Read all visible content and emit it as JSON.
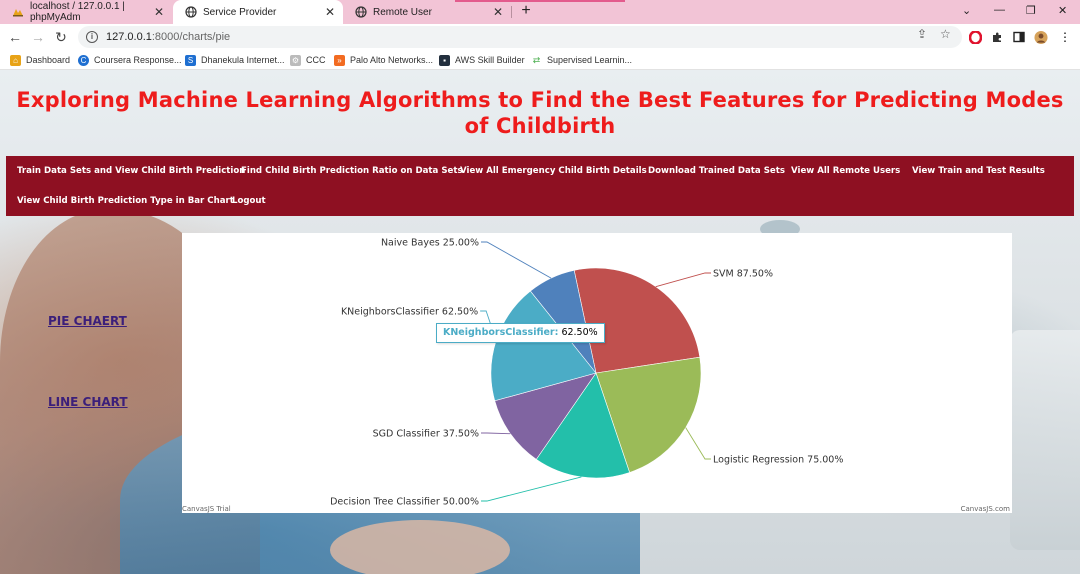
{
  "browser": {
    "tabs": [
      {
        "title": "localhost / 127.0.0.1 | phpMyAdm",
        "icon": "phpmyadmin-icon"
      },
      {
        "title": "Service Provider",
        "icon": "globe-icon"
      },
      {
        "title": "Remote User",
        "icon": "globe-icon"
      }
    ],
    "url_host": "127.0.0.1",
    "url_path": ":8000/charts/pie",
    "bookmarks": [
      {
        "label": "Dashboard",
        "icon": "home-icon",
        "color": "#e8a317"
      },
      {
        "label": "Coursera Response...",
        "icon": "coursera-icon",
        "color": "#1f6fd1"
      },
      {
        "label": "Dhanekula Internet...",
        "icon": "s-icon",
        "color": "#1f6fd1"
      },
      {
        "label": "CCC",
        "icon": "ccc-icon",
        "color": "#999999"
      },
      {
        "label": "Palo Alto Networks...",
        "icon": "paloalto-icon",
        "color": "#f26b21"
      },
      {
        "label": "AWS Skill Builder",
        "icon": "aws-icon",
        "color": "#232f3e"
      },
      {
        "label": "Supervised Learnin...",
        "icon": "arrows-icon",
        "color": "#4caf50"
      }
    ]
  },
  "page": {
    "title": "Exploring Machine Learning Algorithms to Find the Best Features for Predicting Modes of Childbirth",
    "nav": [
      "Train Data Sets and View Child Birth Prediction",
      "Find Child Birth Prediction Ratio on Data Sets",
      "View All Emergency Child Birth Details",
      "Download Trained Data Sets",
      "View All Remote Users",
      "View Train and Test Results",
      "View Child Birth Prediction Type in Bar Chart",
      "Logout"
    ],
    "side_links": {
      "pie": "PIE CHAERT",
      "line": "LINE CHART"
    },
    "credits": {
      "left": "CanvasJS Trial",
      "right": "CanvasJS.com"
    },
    "tooltip": {
      "label": "KNeighborsClassifier:",
      "value": "62.50%"
    }
  },
  "chart_data": {
    "type": "pie",
    "slices": [
      {
        "name": "SVM",
        "value": 87.5,
        "label": "SVM 87.50%",
        "color": "#c0504e"
      },
      {
        "name": "Logistic Regression",
        "value": 75.0,
        "label": "Logistic Regression 75.00%",
        "color": "#9bbb58"
      },
      {
        "name": "Decision Tree Classifier",
        "value": 50.0,
        "label": "Decision Tree Classifier 50.00%",
        "color": "#23bfaa"
      },
      {
        "name": "SGD Classifier",
        "value": 37.5,
        "label": "SGD Classifier 37.50%",
        "color": "#8064a1"
      },
      {
        "name": "KNeighborsClassifier",
        "value": 62.5,
        "label": "KNeighborsClassifier 62.50%",
        "color": "#4bacc6"
      },
      {
        "name": "Naive Bayes",
        "value": 25.0,
        "label": "Naive Bayes 25.00%",
        "color": "#4f81bc"
      }
    ]
  }
}
